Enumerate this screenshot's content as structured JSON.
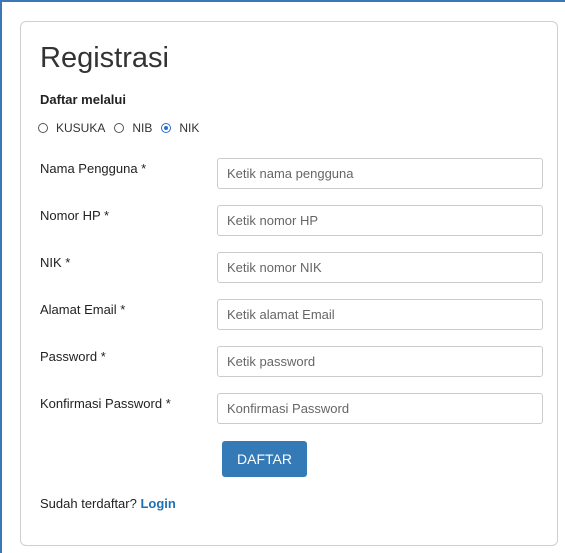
{
  "form": {
    "title": "Registrasi",
    "register_via_label": "Daftar melalui",
    "options": [
      {
        "label": "KUSUKA",
        "checked": false
      },
      {
        "label": "NIB",
        "checked": false
      },
      {
        "label": "NIK",
        "checked": true
      }
    ],
    "fields": [
      {
        "label": "Nama Pengguna *",
        "placeholder": "Ketik nama pengguna",
        "value": ""
      },
      {
        "label": "Nomor HP *",
        "placeholder": "Ketik nomor HP",
        "value": ""
      },
      {
        "label": "NIK *",
        "placeholder": "Ketik nomor NIK",
        "value": ""
      },
      {
        "label": "Alamat Email *",
        "placeholder": "Ketik alamat Email",
        "value": ""
      },
      {
        "label": "Password *",
        "placeholder": "Ketik password",
        "value": ""
      },
      {
        "label": "Konfirmasi Password *",
        "placeholder": "Konfirmasi Password",
        "value": ""
      }
    ],
    "submit_label": "DAFTAR",
    "already_registered_text": "Sudah terdaftar?",
    "login_link_text": "Login"
  },
  "colors": {
    "accent": "#337ab7",
    "link": "#1f6fb5",
    "radio_checked": "#2a6fc9"
  }
}
